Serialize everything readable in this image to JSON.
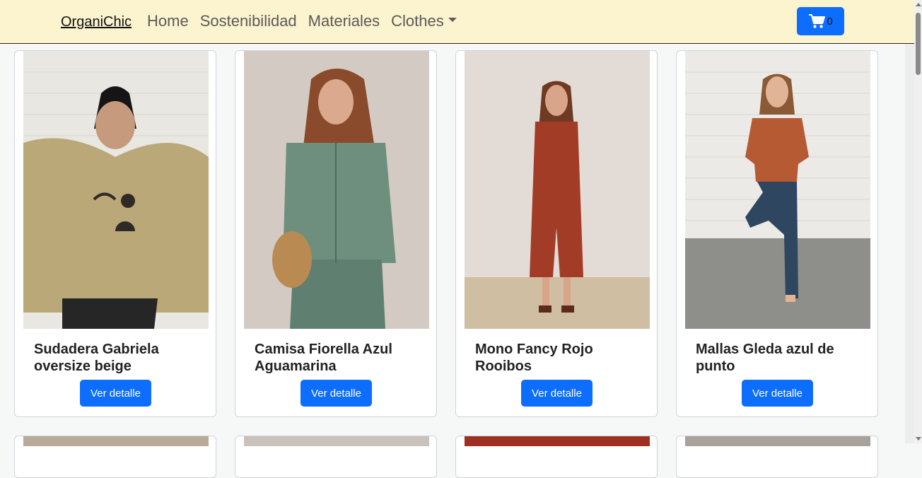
{
  "navbar": {
    "brand": "OrganiChic",
    "links": [
      "Home",
      "Sostenibilidad",
      "Materiales"
    ],
    "dropdown": "Clothes",
    "cart_count": "0",
    "cart_icon": "shopping-cart-icon",
    "background": "#fcf3cf"
  },
  "products": [
    {
      "title": "Sudadera Gabriela oversize beige",
      "button": "Ver detalle"
    },
    {
      "title": "Camisa Fiorella Azul Aguamarina",
      "button": "Ver detalle"
    },
    {
      "title": "Mono Fancy Rojo Rooibos",
      "button": "Ver detalle"
    },
    {
      "title": "Mallas Gleda azul de punto",
      "button": "Ver detalle"
    }
  ],
  "colors": {
    "primary": "#0d6efd"
  }
}
